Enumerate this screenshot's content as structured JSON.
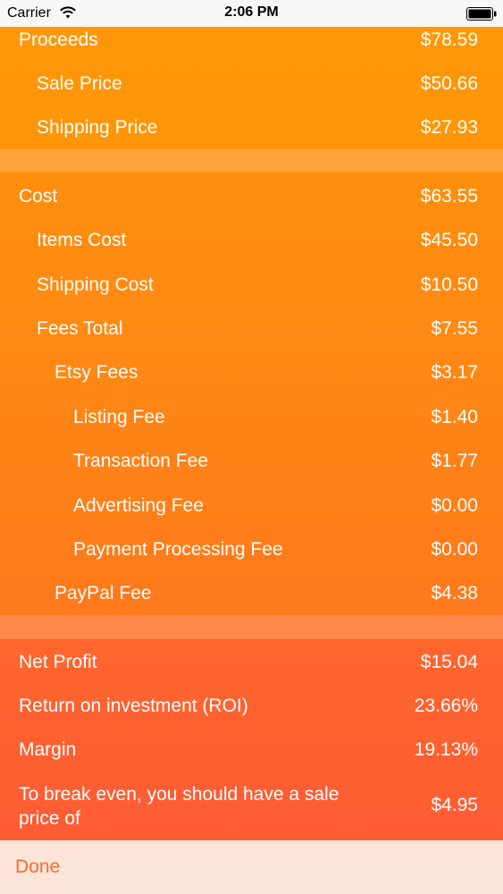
{
  "status_bar": {
    "carrier": "Carrier",
    "time": "2:06 PM"
  },
  "proceeds": [
    {
      "label": "Proceeds",
      "value": "$78.59",
      "indent": 0
    },
    {
      "label": "Sale Price",
      "value": "$50.66",
      "indent": 1
    },
    {
      "label": "Shipping Price",
      "value": "$27.93",
      "indent": 1
    }
  ],
  "cost": [
    {
      "label": "Cost",
      "value": "$63.55",
      "indent": 0
    },
    {
      "label": "Items Cost",
      "value": "$45.50",
      "indent": 1
    },
    {
      "label": "Shipping Cost",
      "value": "$10.50",
      "indent": 1
    },
    {
      "label": "Fees Total",
      "value": "$7.55",
      "indent": 1
    },
    {
      "label": "Etsy Fees",
      "value": "$3.17",
      "indent": 2
    },
    {
      "label": "Listing Fee",
      "value": "$1.40",
      "indent": 3
    },
    {
      "label": "Transaction Fee",
      "value": "$1.77",
      "indent": 3
    },
    {
      "label": "Advertising Fee",
      "value": "$0.00",
      "indent": 3
    },
    {
      "label": "Payment Processing Fee",
      "value": "$0.00",
      "indent": 3
    },
    {
      "label": "PayPal Fee",
      "value": "$4.38",
      "indent": 2
    }
  ],
  "summary": [
    {
      "label": "Net Profit",
      "value": "$15.04",
      "indent": 0
    },
    {
      "label": "Return on investment (ROI)",
      "value": "23.66%",
      "indent": 0
    },
    {
      "label": "Margin",
      "value": "19.13%",
      "indent": 0
    },
    {
      "label": "To break even, you should have a sale price of",
      "value": "$4.95",
      "indent": 0
    }
  ],
  "toolbar": {
    "done_label": "Done"
  },
  "colors": {
    "accent": "#ff6a2e",
    "gradient_top": "#ff9a10",
    "gradient_bottom": "#ff5a3a"
  }
}
